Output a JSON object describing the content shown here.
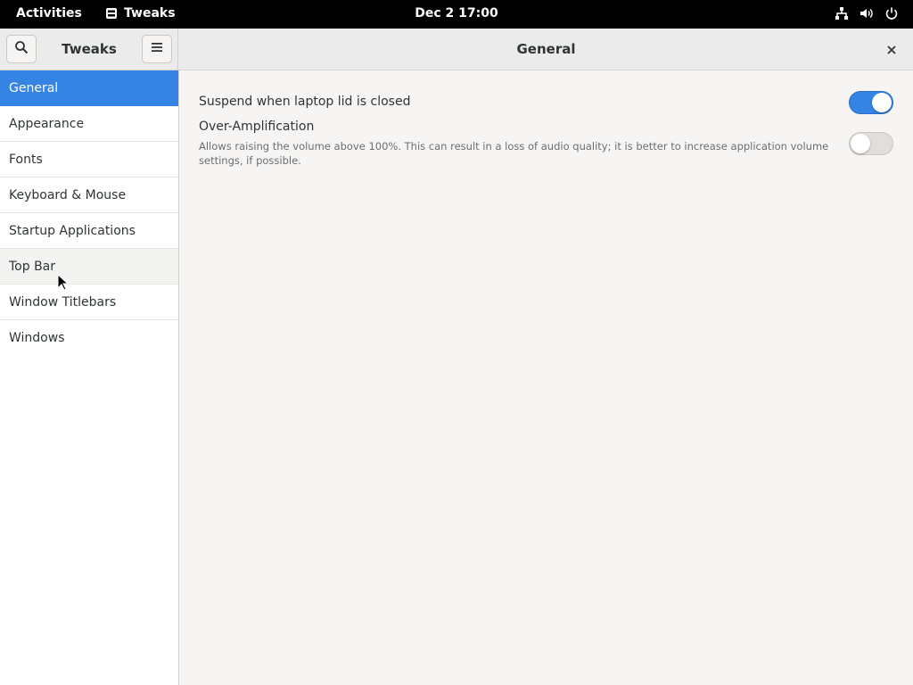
{
  "topbar": {
    "activities": "Activities",
    "app_name": "Tweaks",
    "clock": "Dec 2  17:00",
    "tray_icons": [
      "network-icon",
      "volume-icon",
      "power-icon"
    ]
  },
  "header": {
    "sidebar_title": "Tweaks",
    "main_title": "General"
  },
  "sidebar": {
    "items": [
      {
        "label": "General",
        "selected": true
      },
      {
        "label": "Appearance"
      },
      {
        "label": "Fonts"
      },
      {
        "label": "Keyboard & Mouse"
      },
      {
        "label": "Startup Applications"
      },
      {
        "label": "Top Bar",
        "hover": true
      },
      {
        "label": "Window Titlebars"
      },
      {
        "label": "Windows"
      }
    ]
  },
  "settings": {
    "suspend": {
      "label": "Suspend when laptop lid is closed",
      "enabled": true
    },
    "over_amplification": {
      "label": "Over-Amplification",
      "description": "Allows raising the volume above 100%. This can result in a loss of audio quality; it is better to increase application volume settings, if possible.",
      "enabled": false
    }
  },
  "colors": {
    "accent": "#3584e4",
    "topbar_bg": "#000000",
    "headerbar_bg": "#ebebeb"
  }
}
